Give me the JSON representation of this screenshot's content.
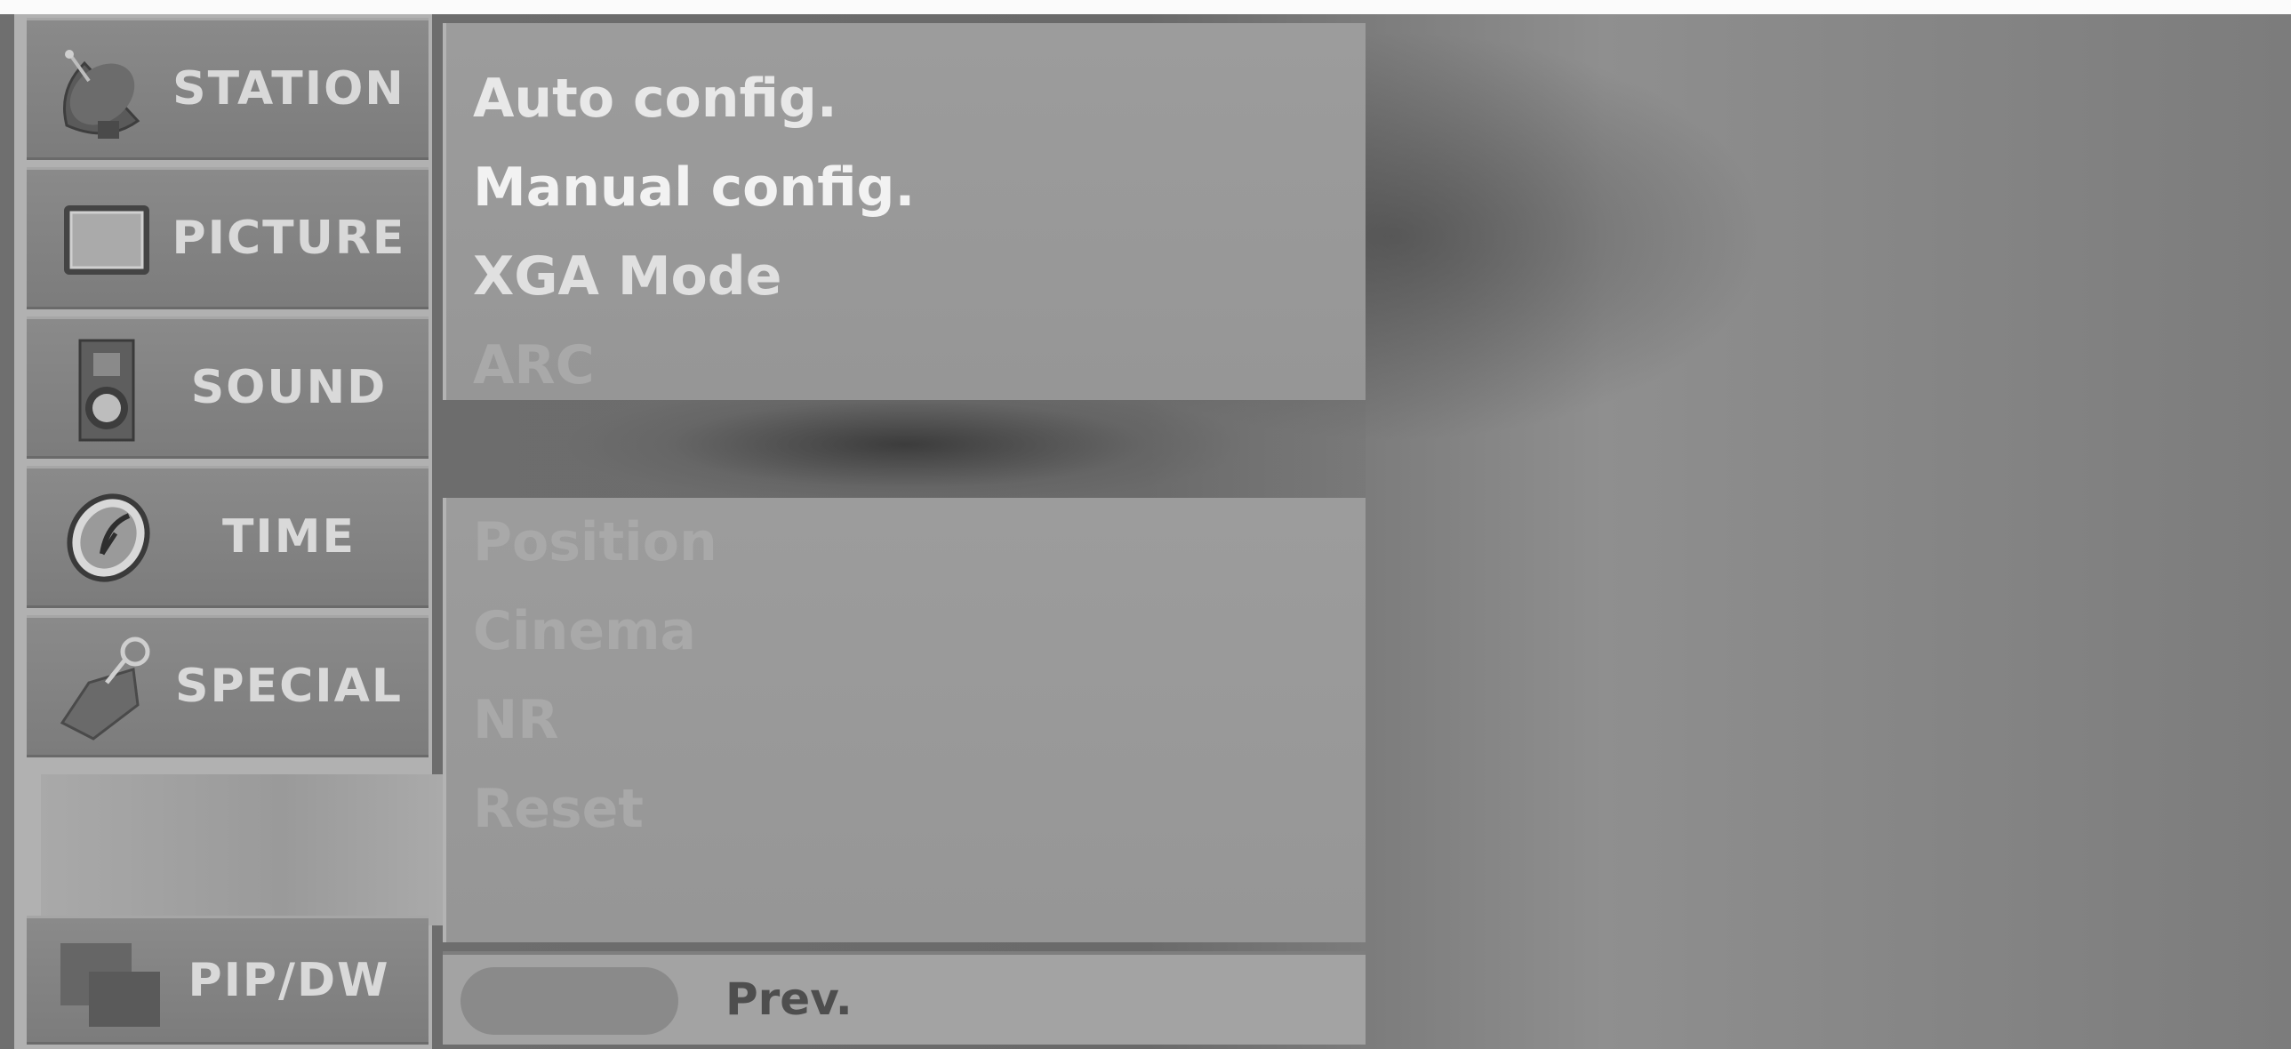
{
  "sidebar": {
    "items": [
      {
        "label": "STATION",
        "icon": "satellite-dish-icon"
      },
      {
        "label": "PICTURE",
        "icon": "tv-screen-icon"
      },
      {
        "label": "SOUND",
        "icon": "speaker-icon"
      },
      {
        "label": "TIME",
        "icon": "clock-icon"
      },
      {
        "label": "SPECIAL",
        "icon": "tag-icon"
      }
    ],
    "pip": {
      "label": "PIP/DW",
      "icon": "pip-windows-icon"
    }
  },
  "menu": {
    "group1": [
      "Auto config.",
      "Manual config.",
      "XGA Mode",
      "ARC"
    ],
    "group2": [
      "Position",
      "Cinema",
      "NR",
      "Reset"
    ]
  },
  "footer": {
    "prev_label": "Prev."
  },
  "colors": {
    "selected_text": "#f2f2f2",
    "normal_text": "#e4e4e4",
    "disabled_text": "#a9a9a9",
    "sidebar_text": "#d9d9d9"
  }
}
